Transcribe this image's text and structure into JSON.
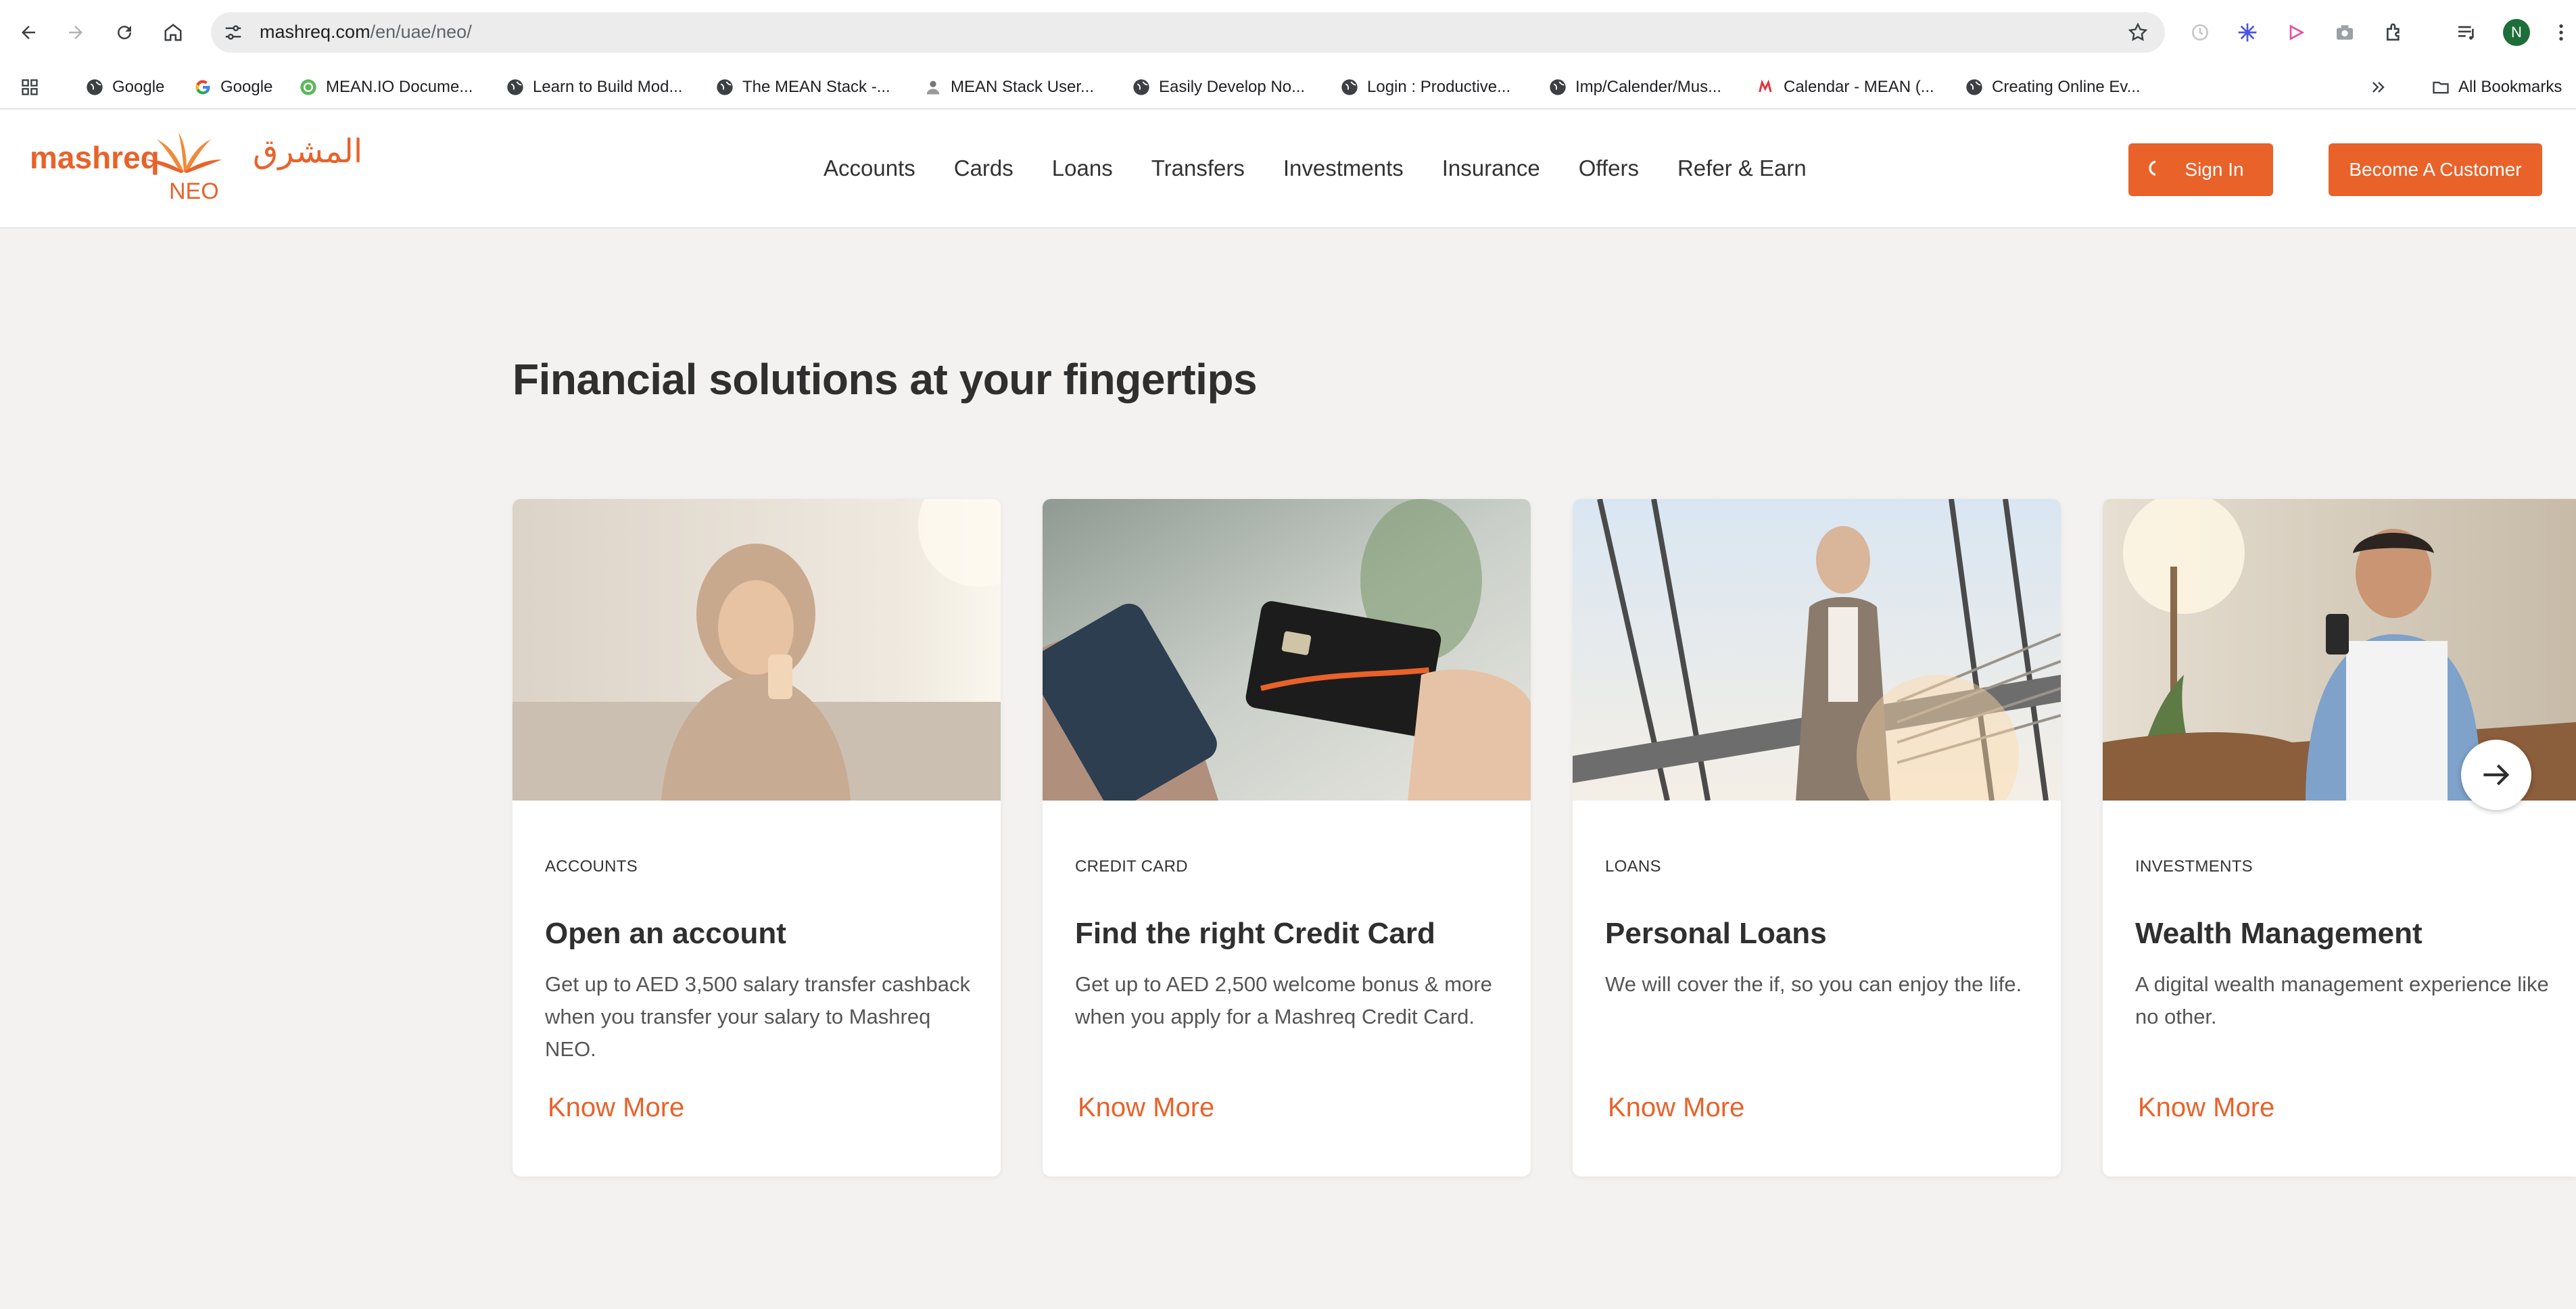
{
  "browser": {
    "url_host": "mashreq.com",
    "url_path": "/en/uae/neo/",
    "avatar_letter": "N",
    "bookmarks": [
      {
        "label": "Google",
        "icon": "globe-icon"
      },
      {
        "label": "Google",
        "icon": "google-icon"
      },
      {
        "label": "MEAN.IO Docume...",
        "icon": "meanio-icon"
      },
      {
        "label": "Learn to Build Mod...",
        "icon": "globe-icon"
      },
      {
        "label": "The MEAN Stack -...",
        "icon": "globe-icon"
      },
      {
        "label": "MEAN Stack User...",
        "icon": "user-group-icon"
      },
      {
        "label": "Easily Develop No...",
        "icon": "globe-icon"
      },
      {
        "label": "Login : Productive...",
        "icon": "globe-icon"
      },
      {
        "label": "Imp/Calender/Mus...",
        "icon": "globe-icon"
      },
      {
        "label": "Calendar - MEAN (...",
        "icon": "meetup-icon"
      },
      {
        "label": "Creating Online Ev...",
        "icon": "globe-icon"
      }
    ],
    "all_bookmarks_label": "All Bookmarks"
  },
  "header": {
    "logo_latin": "mashreq",
    "logo_arabic": "المشرق",
    "logo_sub": "NEO",
    "nav": [
      "Accounts",
      "Cards",
      "Loans",
      "Transfers",
      "Investments",
      "Insurance",
      "Offers",
      "Refer & Earn"
    ],
    "sign_in": "Sign In",
    "become_customer": "Become A Customer"
  },
  "main": {
    "headline": "Financial solutions at your fingertips",
    "cards": [
      {
        "category": "ACCOUNTS",
        "title": "Open an account",
        "desc": "Get up to AED 3,500 salary transfer cashback when you transfer your salary to Mashreq NEO.",
        "link": "Know More"
      },
      {
        "category": "CREDIT CARD",
        "title": "Find the right Credit Card",
        "desc": "Get up to AED 2,500 welcome bonus & more when you apply for a Mashreq Credit Card.",
        "link": "Know More"
      },
      {
        "category": "LOANS",
        "title": "Personal Loans",
        "desc": "We will cover the if, so you can enjoy the life.",
        "link": "Know More"
      },
      {
        "category": "INVESTMENTS",
        "title": "Wealth Management",
        "desc": "A digital wealth management experience like no other.",
        "link": "Know More"
      }
    ]
  },
  "colors": {
    "brand": "#e8622a",
    "page_bg": "#f3f2f0"
  }
}
